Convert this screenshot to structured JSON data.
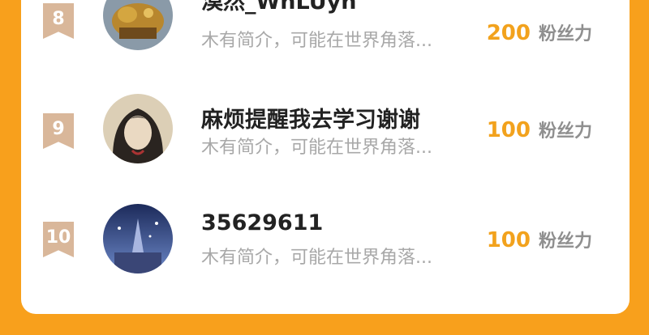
{
  "rankings": [
    {
      "rank": "8",
      "name": "漠然_WhLUyh",
      "bio": "木有简介，可能在世界角落...",
      "fans_count": "200",
      "fans_label": "粉丝力"
    },
    {
      "rank": "9",
      "name": "麻烦提醒我去学习谢谢",
      "bio": "木有简介，可能在世界角落...",
      "fans_count": "100",
      "fans_label": "粉丝力"
    },
    {
      "rank": "10",
      "name": "35629611",
      "bio": "木有简介，可能在世界角落...",
      "fans_count": "100",
      "fans_label": "粉丝力"
    }
  ]
}
